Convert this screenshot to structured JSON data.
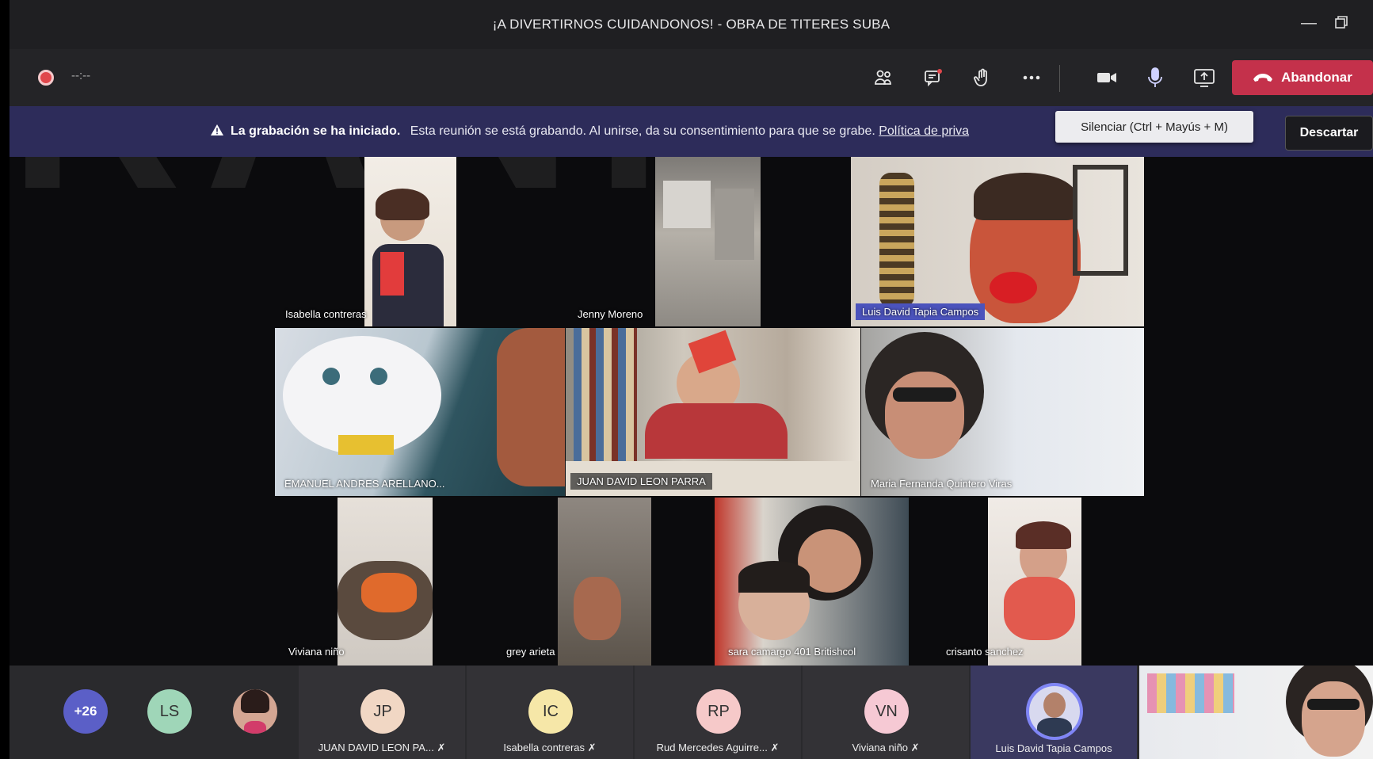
{
  "window": {
    "title": "¡A DIVERTIRNOS CUIDANDONOS! - OBRA DE TITERES SUBA"
  },
  "watermark": "RANI",
  "toolbar": {
    "timer": "--:--",
    "icons": [
      "participants-icon",
      "chat-icon",
      "raise-hand-icon",
      "more-icon",
      "camera-icon",
      "microphone-icon",
      "share-screen-icon"
    ],
    "leave_label": "Abandonar"
  },
  "banner": {
    "bold": "La grabación se ha iniciado.",
    "text": "Esta reunión se está grabando. Al unirse, da su consentimiento para que se grabe.",
    "link": "Política de priva",
    "dismiss_label": "Descartar"
  },
  "tooltip": "Silenciar (Ctrl + Mayús + M)",
  "stage": {
    "tiles": [
      {
        "name": "Isabella contreras"
      },
      {
        "name": "Jenny Moreno"
      },
      {
        "name": "Luis David Tapia Campos"
      },
      {
        "name": "EMANUEL ANDRES ARELLANO..."
      },
      {
        "name": "JUAN DAVID LEON PARRA"
      },
      {
        "name": "Maria Fernanda Quintero Viras"
      },
      {
        "name": "Viviana niño"
      },
      {
        "name": "grey arieta"
      },
      {
        "name": "sara camargo 401 Britishcol"
      },
      {
        "name": "crisanto sanchez"
      }
    ]
  },
  "roster": {
    "overflow": "+26",
    "avatars": [
      {
        "initials": "LS",
        "color": "#9fd6b8"
      }
    ],
    "cards": [
      {
        "initials": "JP",
        "name": "JUAN DAVID LEON PA...",
        "color": "#f1d7c4"
      },
      {
        "initials": "IC",
        "name": "Isabella contreras",
        "color": "#f6e7a8"
      },
      {
        "initials": "RP",
        "name": "Rud Mercedes Aguirre...",
        "color": "#f6c9c9"
      },
      {
        "initials": "VN",
        "name": "Viviana niño",
        "color": "#f6c9d4"
      },
      {
        "initials": "",
        "name": "Luis David Tapia Campos",
        "color": "#4b53bc"
      }
    ]
  },
  "colors": {
    "leave": "#c4314b",
    "banner": "#2d2c5a",
    "accent": "#4b53bc",
    "overflow": "#5b5fc7"
  }
}
